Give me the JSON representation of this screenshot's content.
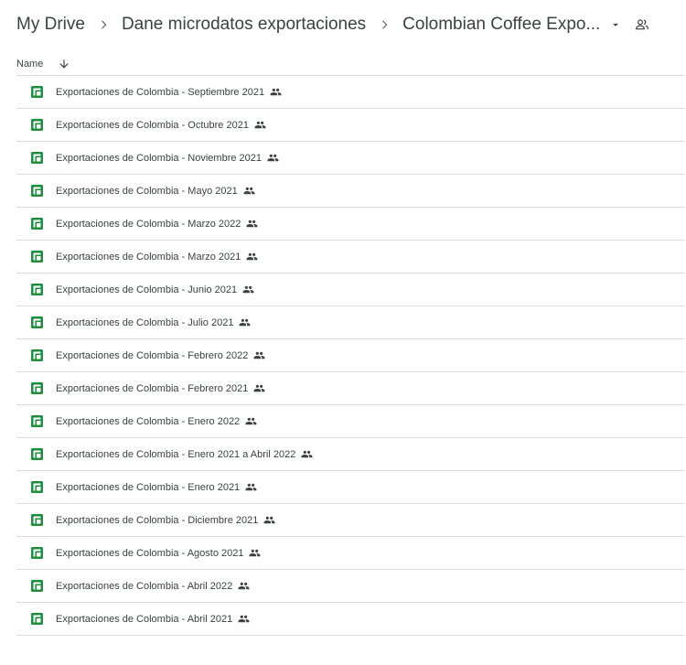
{
  "breadcrumb": {
    "items": [
      "My Drive",
      "Dane microdatos exportaciones",
      "Colombian Coffee Expo..."
    ]
  },
  "header": {
    "name_label": "Name",
    "sort_direction": "descending"
  },
  "icons": {
    "file_type": "google-sheets-icon",
    "shared": "people-icon",
    "separator": "chevron-right-icon",
    "sort": "arrow-down-icon",
    "dropdown": "caret-down-icon",
    "folder_shared": "shared-folder-icon"
  },
  "colors": {
    "sheets_green": "#1e8e3e",
    "text": "#3c4043",
    "divider": "#dadce0"
  },
  "files": [
    {
      "name": "Exportaciones de Colombia - Septiembre 2021",
      "shared": true
    },
    {
      "name": "Exportaciones de Colombia - Octubre 2021",
      "shared": true
    },
    {
      "name": "Exportaciones de Colombia - Noviembre 2021",
      "shared": true
    },
    {
      "name": "Exportaciones de Colombia - Mayo 2021",
      "shared": true
    },
    {
      "name": "Exportaciones de Colombia - Marzo 2022",
      "shared": true
    },
    {
      "name": "Exportaciones de Colombia - Marzo 2021",
      "shared": true
    },
    {
      "name": "Exportaciones de Colombia - Junio 2021",
      "shared": true
    },
    {
      "name": "Exportaciones de Colombia - Julio 2021",
      "shared": true
    },
    {
      "name": "Exportaciones de Colombia - Febrero 2022",
      "shared": true
    },
    {
      "name": "Exportaciones de Colombia - Febrero 2021",
      "shared": true
    },
    {
      "name": "Exportaciones de Colombia - Enero 2022",
      "shared": true
    },
    {
      "name": "Exportaciones de Colombia - Enero 2021 a Abril 2022",
      "shared": true
    },
    {
      "name": "Exportaciones de Colombia - Enero 2021",
      "shared": true
    },
    {
      "name": "Exportaciones de Colombia - Diciembre 2021",
      "shared": true
    },
    {
      "name": "Exportaciones de Colombia - Agosto 2021",
      "shared": true
    },
    {
      "name": "Exportaciones de Colombia - Abril 2022",
      "shared": true
    },
    {
      "name": "Exportaciones de Colombia - Abril 2021",
      "shared": true
    }
  ]
}
